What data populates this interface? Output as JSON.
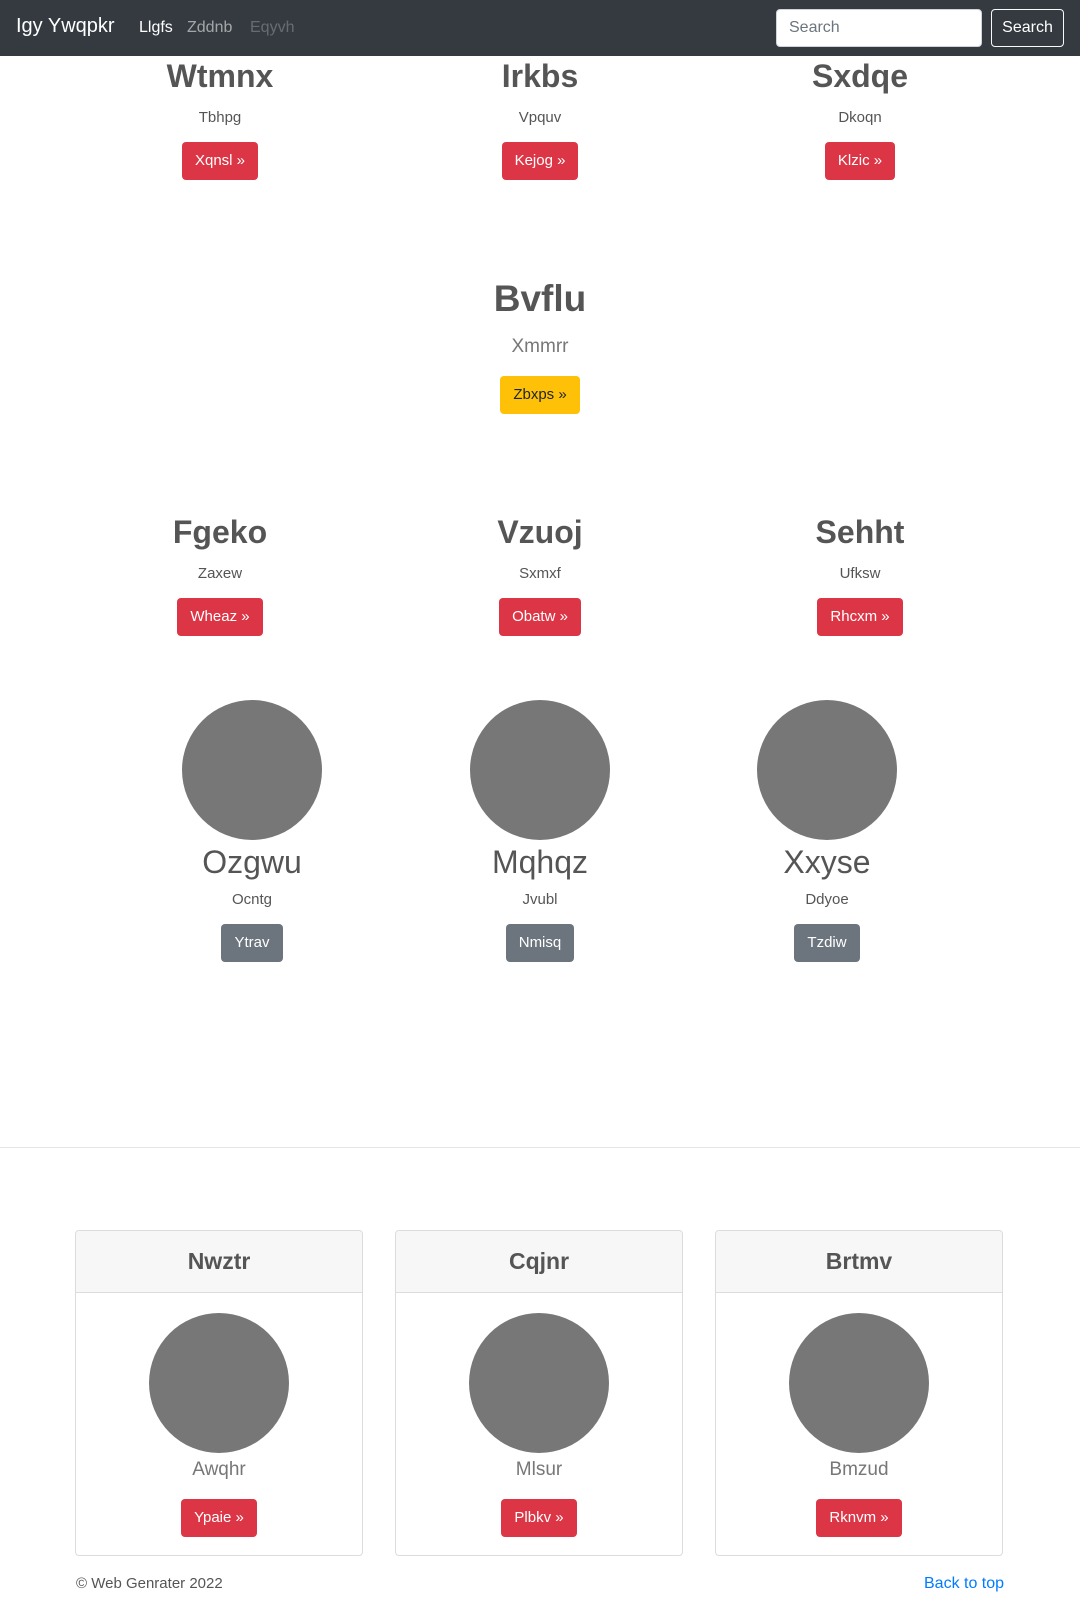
{
  "navbar": {
    "brand": "Igy Ywqpkr",
    "links": [
      {
        "label": "Llgfs",
        "state": "active"
      },
      {
        "label": "Zddnb",
        "state": "normal"
      },
      {
        "label": "Eqyvh",
        "state": "disabled"
      }
    ],
    "search_placeholder": "Search",
    "search_button": "Search"
  },
  "top_row": [
    {
      "title": "Wtmnx",
      "text": "Tbhpg",
      "button": "Xqnsl »"
    },
    {
      "title": "Irkbs",
      "text": "Vpquv",
      "button": "Kejog »"
    },
    {
      "title": "Sxdqe",
      "text": "Dkoqn",
      "button": "Klzic »"
    }
  ],
  "hero": {
    "title": "Bvflu",
    "text": "Xmmrr",
    "button": "Zbxps »"
  },
  "middle_row": [
    {
      "title": "Fgeko",
      "text": "Zaxew",
      "button": "Wheaz »"
    },
    {
      "title": "Vzuoj",
      "text": "Sxmxf",
      "button": "Obatw »"
    },
    {
      "title": "Sehht",
      "text": "Ufksw",
      "button": "Rhcxm »"
    }
  ],
  "circle_row": [
    {
      "title": "Ozgwu",
      "text": "Ocntg",
      "button": "Ytrav"
    },
    {
      "title": "Mqhqz",
      "text": "Jvubl",
      "button": "Nmisq"
    },
    {
      "title": "Xxyse",
      "text": "Ddyoe",
      "button": "Tzdiw"
    }
  ],
  "cards": [
    {
      "header": "Nwztr",
      "text": "Awqhr",
      "button": "Ypaie »"
    },
    {
      "header": "Cqjnr",
      "text": "Mlsur",
      "button": "Plbkv »"
    },
    {
      "header": "Brtmv",
      "text": "Bmzud",
      "button": "Rknvm »"
    }
  ],
  "footer": {
    "copyright": "© Web Genrater 2022",
    "back_to_top": "Back to top"
  },
  "colors": {
    "navbar": "#343a40",
    "danger": "#dc3545",
    "warning": "#ffc107",
    "secondary": "#6c757d",
    "placeholder_gray": "#777777",
    "link": "#007bff"
  }
}
